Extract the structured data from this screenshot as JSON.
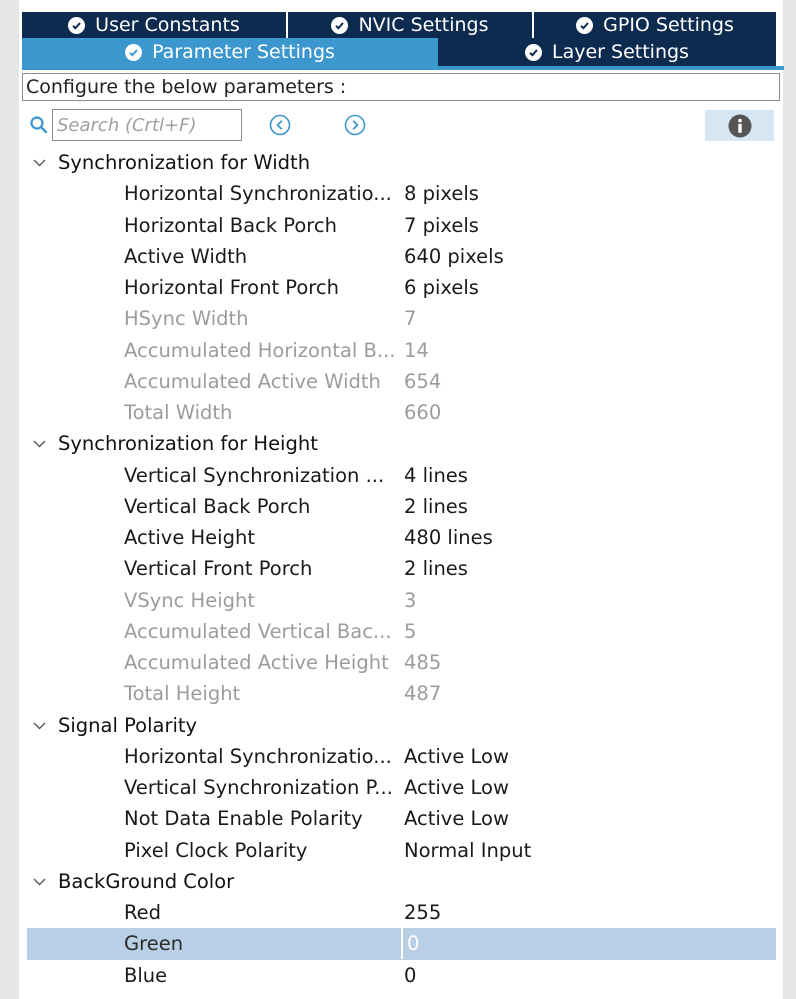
{
  "colors": {
    "tab_dark": "#0d2a4f",
    "tab_active": "#3c97cf",
    "selected_row": "#b8cfe5",
    "disabled_text": "#9c9c9c",
    "icon_blue": "#3c97cf"
  },
  "tabs": {
    "row1": [
      {
        "label": "User Constants",
        "icon": "check-circle-icon"
      },
      {
        "label": "NVIC Settings",
        "icon": "check-circle-icon"
      },
      {
        "label": "GPIO Settings",
        "icon": "check-circle-icon"
      }
    ],
    "row2": [
      {
        "label": "Parameter Settings",
        "icon": "check-circle-icon",
        "active": true
      },
      {
        "label": "Layer Settings",
        "icon": "check-circle-icon",
        "active": false
      }
    ]
  },
  "config_label": "Configure the below parameters :",
  "search": {
    "placeholder": "Search (Crtl+F)",
    "value": "",
    "icons": [
      "search-icon",
      "previous-icon",
      "next-icon",
      "info-icon"
    ]
  },
  "groups": [
    {
      "title": "Synchronization for Width",
      "expanded": true,
      "params": [
        {
          "name": "Horizontal Synchronizatio...",
          "value": "8 pixels",
          "enabled": true
        },
        {
          "name": "Horizontal Back Porch",
          "value": "7 pixels",
          "enabled": true
        },
        {
          "name": "Active Width",
          "value": "640 pixels",
          "enabled": true
        },
        {
          "name": "Horizontal Front Porch",
          "value": "6 pixels",
          "enabled": true
        },
        {
          "name": "HSync Width",
          "value": "7",
          "enabled": false
        },
        {
          "name": "Accumulated Horizontal B...",
          "value": "14",
          "enabled": false
        },
        {
          "name": "Accumulated Active Width",
          "value": "654",
          "enabled": false
        },
        {
          "name": "Total Width",
          "value": "660",
          "enabled": false
        }
      ]
    },
    {
      "title": "Synchronization for Height",
      "expanded": true,
      "params": [
        {
          "name": "Vertical Synchronization ...",
          "value": "4 lines",
          "enabled": true
        },
        {
          "name": "Vertical Back Porch",
          "value": "2 lines",
          "enabled": true
        },
        {
          "name": "Active Height",
          "value": "480 lines",
          "enabled": true
        },
        {
          "name": "Vertical Front Porch",
          "value": "2 lines",
          "enabled": true
        },
        {
          "name": "VSync Height",
          "value": "3",
          "enabled": false
        },
        {
          "name": "Accumulated Vertical Bac...",
          "value": "5",
          "enabled": false
        },
        {
          "name": "Accumulated Active Height",
          "value": "485",
          "enabled": false
        },
        {
          "name": "Total Height",
          "value": "487",
          "enabled": false
        }
      ]
    },
    {
      "title": "Signal Polarity",
      "expanded": true,
      "params": [
        {
          "name": "Horizontal Synchronizatio...",
          "value": "Active Low",
          "enabled": true
        },
        {
          "name": "Vertical Synchronization P...",
          "value": "Active Low",
          "enabled": true
        },
        {
          "name": "Not Data Enable Polarity",
          "value": "Active Low",
          "enabled": true
        },
        {
          "name": "Pixel Clock Polarity",
          "value": "Normal Input",
          "enabled": true
        }
      ]
    },
    {
      "title": "BackGround Color",
      "expanded": true,
      "params": [
        {
          "name": "Red",
          "value": "255",
          "enabled": true
        },
        {
          "name": "Green",
          "value": "0",
          "enabled": true,
          "selected": true
        },
        {
          "name": "Blue",
          "value": "0",
          "enabled": true
        }
      ]
    }
  ]
}
